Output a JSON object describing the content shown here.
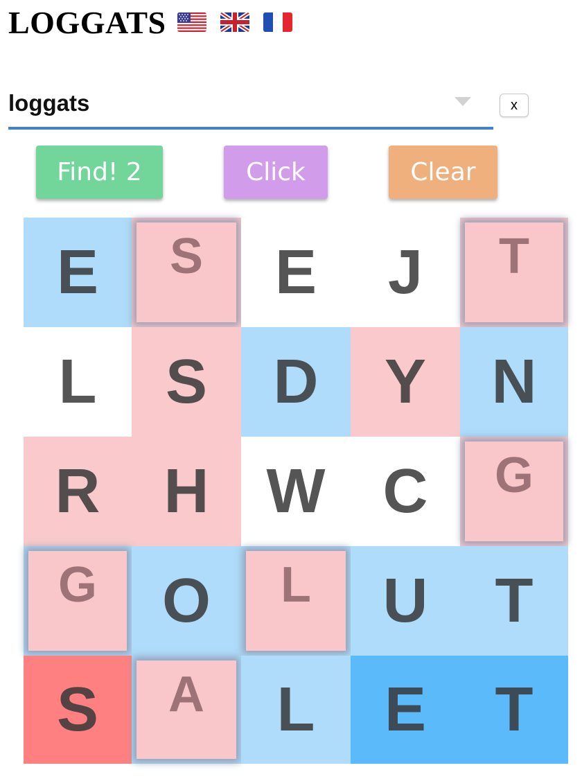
{
  "header": {
    "title": "LOGGATS",
    "flags": [
      "us-flag-icon",
      "uk-flag-icon",
      "fr-flag-icon"
    ]
  },
  "select": {
    "value": "loggats",
    "clear_label": "x"
  },
  "buttons": {
    "find_label": "Find! 2",
    "click_label": "Click",
    "clear_label": "Clear"
  },
  "colors": {
    "blue": "#aedcfa",
    "pink": "#f9c9cb",
    "white": "#ffffff",
    "red": "#ff8080",
    "deep_blue": "#5bbbfa",
    "underline": "#3b82e0"
  },
  "grid": {
    "rows": [
      [
        {
          "letter": "E",
          "color": "blue",
          "tile": false
        },
        {
          "letter": "S",
          "color": "pink",
          "tile": true
        },
        {
          "letter": "E",
          "color": "white",
          "tile": false
        },
        {
          "letter": "J",
          "color": "white",
          "tile": false
        },
        {
          "letter": "T",
          "color": "pink",
          "tile": true
        }
      ],
      [
        {
          "letter": "L",
          "color": "white",
          "tile": false
        },
        {
          "letter": "S",
          "color": "pink",
          "tile": false
        },
        {
          "letter": "D",
          "color": "blue",
          "tile": false
        },
        {
          "letter": "Y",
          "color": "pink",
          "tile": false
        },
        {
          "letter": "N",
          "color": "blue",
          "tile": false
        }
      ],
      [
        {
          "letter": "R",
          "color": "pink",
          "tile": false
        },
        {
          "letter": "H",
          "color": "pink",
          "tile": false
        },
        {
          "letter": "W",
          "color": "white",
          "tile": false
        },
        {
          "letter": "C",
          "color": "white",
          "tile": false
        },
        {
          "letter": "G",
          "color": "pink",
          "tile": true
        }
      ],
      [
        {
          "letter": "G",
          "color": "blue",
          "tile": true
        },
        {
          "letter": "O",
          "color": "blue",
          "tile": false
        },
        {
          "letter": "L",
          "color": "blue",
          "tile": true
        },
        {
          "letter": "U",
          "color": "blue",
          "tile": false
        },
        {
          "letter": "T",
          "color": "blue",
          "tile": false
        }
      ],
      [
        {
          "letter": "S",
          "color": "red",
          "tile": false
        },
        {
          "letter": "A",
          "color": "blue",
          "tile": true
        },
        {
          "letter": "L",
          "color": "blue",
          "tile": false
        },
        {
          "letter": "E",
          "color": "deep_blue",
          "tile": false
        },
        {
          "letter": "T",
          "color": "deep_blue",
          "tile": false
        }
      ]
    ]
  }
}
